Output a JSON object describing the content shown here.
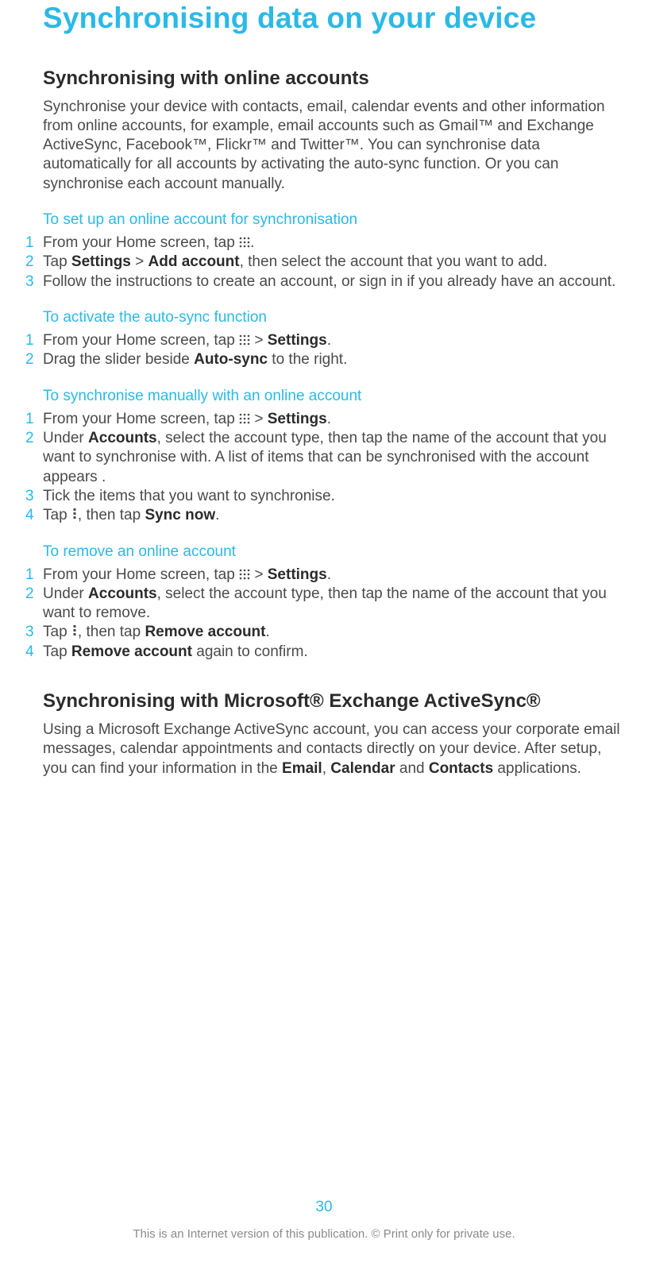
{
  "title": "Synchronising data on your device",
  "section1": {
    "heading": "Synchronising with online accounts",
    "intro": "Synchronise your device with contacts, email, calendar events and other information from online accounts, for example, email accounts such as Gmail™ and Exchange ActiveSync, Facebook™, Flickr™ and Twitter™. You can synchronise data automatically for all accounts by activating the auto-sync function. Or you can synchronise each account manually."
  },
  "block1": {
    "heading": "To set up an online account for synchronisation",
    "s1a": "From your Home screen, tap ",
    "s1b": ".",
    "s2a": "Tap ",
    "s2b": "Settings",
    "s2c": " > ",
    "s2d": "Add account",
    "s2e": ", then select the account that you want to add.",
    "s3": "Follow the instructions to create an account, or sign in if you already have an account."
  },
  "block2": {
    "heading": "To activate the auto-sync function",
    "s1a": "From your Home screen, tap ",
    "s1b": " > ",
    "s1c": "Settings",
    "s1d": ".",
    "s2a": "Drag the slider beside ",
    "s2b": "Auto-sync",
    "s2c": " to the right."
  },
  "block3": {
    "heading": "To synchronise manually with an online account",
    "s1a": "From your Home screen, tap ",
    "s1b": " > ",
    "s1c": "Settings",
    "s1d": ".",
    "s2a": "Under ",
    "s2b": "Accounts",
    "s2c": ", select the account type, then tap the name of the account that you want to synchronise with. A list of items that can be synchronised with the account appears .",
    "s3": "Tick the items that you want to synchronise.",
    "s4a": "Tap ",
    "s4b": ", then tap ",
    "s4c": "Sync now",
    "s4d": "."
  },
  "block4": {
    "heading": "To remove an online account",
    "s1a": "From your Home screen, tap ",
    "s1b": " > ",
    "s1c": "Settings",
    "s1d": ".",
    "s2a": "Under ",
    "s2b": "Accounts",
    "s2c": ", select the account type, then tap the name of the account that you want to remove.",
    "s3a": "Tap ",
    "s3b": ", then tap ",
    "s3c": "Remove account",
    "s3d": ".",
    "s4a": "Tap ",
    "s4b": "Remove account",
    "s4c": " again to confirm."
  },
  "section2": {
    "heading": "Synchronising with Microsoft® Exchange ActiveSync®",
    "p1a": "Using a Microsoft Exchange ActiveSync account, you can access your corporate email messages, calendar appointments and contacts directly on your device. After setup, you can find your information in the ",
    "p1b": "Email",
    "p1c": ", ",
    "p1d": "Calendar",
    "p1e": " and ",
    "p1f": "Contacts",
    "p1g": " applications."
  },
  "footer": {
    "page": "30",
    "note": "This is an Internet version of this publication. © Print only for private use."
  },
  "nums": {
    "n1": "1",
    "n2": "2",
    "n3": "3",
    "n4": "4"
  }
}
